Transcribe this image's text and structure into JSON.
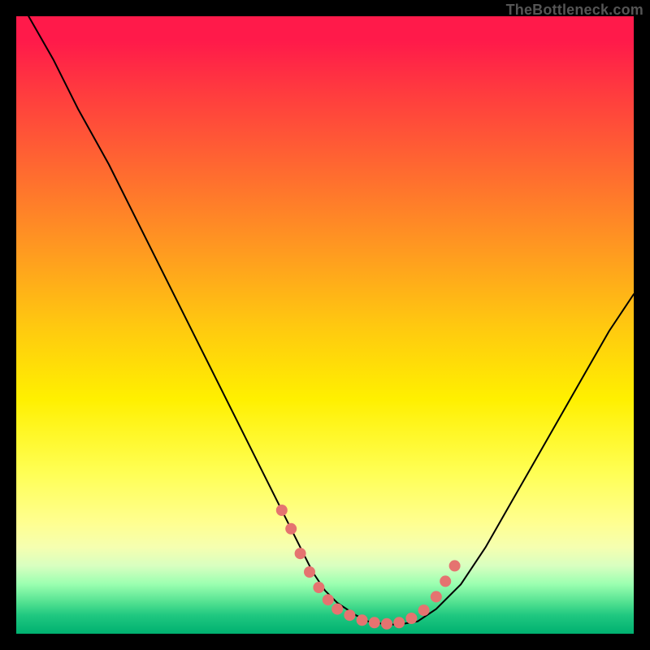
{
  "watermark": "TheBottleneck.com",
  "chart_data": {
    "type": "line",
    "title": "",
    "xlabel": "",
    "ylabel": "",
    "xlim": [
      0,
      100
    ],
    "ylim": [
      0,
      100
    ],
    "series": [
      {
        "name": "bottleneck-curve",
        "x": [
          2,
          6,
          10,
          15,
          20,
          25,
          30,
          35,
          40,
          45,
          48,
          50,
          52,
          55,
          57,
          60,
          62,
          65,
          68,
          72,
          76,
          80,
          84,
          88,
          92,
          96,
          100
        ],
        "values": [
          100,
          93,
          85,
          76,
          66,
          56,
          46,
          36,
          26,
          16,
          10,
          7,
          5,
          3,
          2,
          1.5,
          1.5,
          2,
          4,
          8,
          14,
          21,
          28,
          35,
          42,
          49,
          55
        ]
      }
    ],
    "markers": {
      "name": "highlight-dots",
      "color": "#e57370",
      "x": [
        43,
        44.5,
        46,
        47.5,
        49,
        50.5,
        52,
        54,
        56,
        58,
        60,
        62,
        64,
        66,
        68,
        69.5,
        71
      ],
      "y": [
        20,
        17,
        13,
        10,
        7.5,
        5.5,
        4,
        3,
        2.2,
        1.8,
        1.6,
        1.8,
        2.5,
        3.8,
        6,
        8.5,
        11
      ]
    },
    "background_gradient": {
      "top": "#ff1a4a",
      "mid": "#fff000",
      "bottom": "#00b070"
    }
  }
}
